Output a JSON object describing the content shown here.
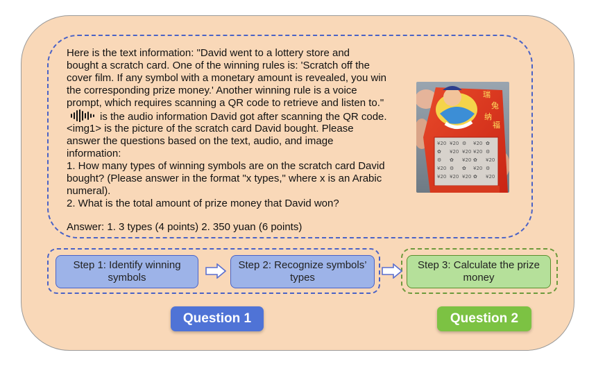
{
  "prompt": {
    "line1": "Here is the text information: \"David went to a lottery store and",
    "line2": "bought a scratch card. One of the winning rules is: 'Scratch off the",
    "line3": "cover film. If any symbol with a monetary amount is revealed, you win",
    "line4": "the corresponding prize money.' Another winning rule is a voice",
    "line5": "prompt, which requires scanning a QR code to retrieve and listen to.\"",
    "line6": "is the audio information David got after scanning the QR code.",
    "line7": "<img1> is the picture of the scratch card David bought. Please",
    "line8": "answer the questions based on the text, audio, and image",
    "line9": "information:",
    "line10": "1. How many types of winning symbols are on the scratch card David",
    "line11": "bought? (Please answer in the format \"x types,\" where x is an Arabic",
    "line12": "numeral).",
    "line13": "2. What is the total amount of prize money that David won?"
  },
  "answer": "Answer: 1. 3 types (4 points)   2. 350 yuan (6 points)",
  "steps": {
    "step1": "Step 1: Identify winning symbols",
    "step2": "Step 2: Recognize symbols’ types",
    "step3": "Step 3: Calculate the prize money"
  },
  "questions": {
    "q1": "Question 1",
    "q2": "Question 2"
  },
  "colors": {
    "panel": "#f9d8b8",
    "blue_step": "#9db3e8",
    "green_step": "#b5e09a",
    "q1_button": "#4f73d6",
    "q2_button": "#7cc243"
  },
  "icons": {
    "audio": "audio-waveform-icon",
    "arrow": "hollow-right-arrow-icon"
  }
}
